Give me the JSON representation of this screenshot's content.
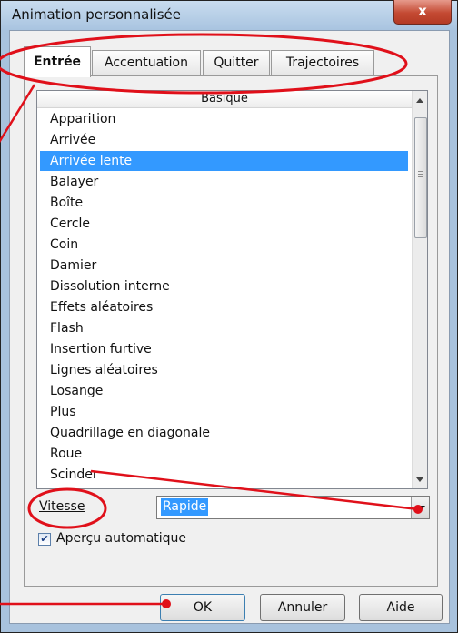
{
  "window": {
    "title": "Animation personnalisée",
    "close_glyph": "x"
  },
  "tabs": [
    {
      "label": "Entrée",
      "active": true
    },
    {
      "label": "Accentuation",
      "active": false
    },
    {
      "label": "Quitter",
      "active": false
    },
    {
      "label": "Trajectoires",
      "active": false
    }
  ],
  "list": {
    "header": "Basique",
    "selected_index": 2,
    "items": [
      "Apparition",
      "Arrivée",
      "Arrivée lente",
      "Balayer",
      "Boîte",
      "Cercle",
      "Coin",
      "Damier",
      "Dissolution interne",
      "Effets aléatoires",
      "Flash",
      "Insertion furtive",
      "Lignes aléatoires",
      "Losange",
      "Plus",
      "Quadrillage en diagonale",
      "Roue",
      "Scinder"
    ]
  },
  "speed": {
    "label": "Vitesse",
    "value": "Rapide"
  },
  "preview": {
    "label": "Aperçu automatique",
    "checked": true
  },
  "buttons": {
    "ok": "OK",
    "cancel": "Annuler",
    "help": "Aide"
  },
  "colors": {
    "selection": "#3399ff",
    "annotation": "#e0101a"
  }
}
